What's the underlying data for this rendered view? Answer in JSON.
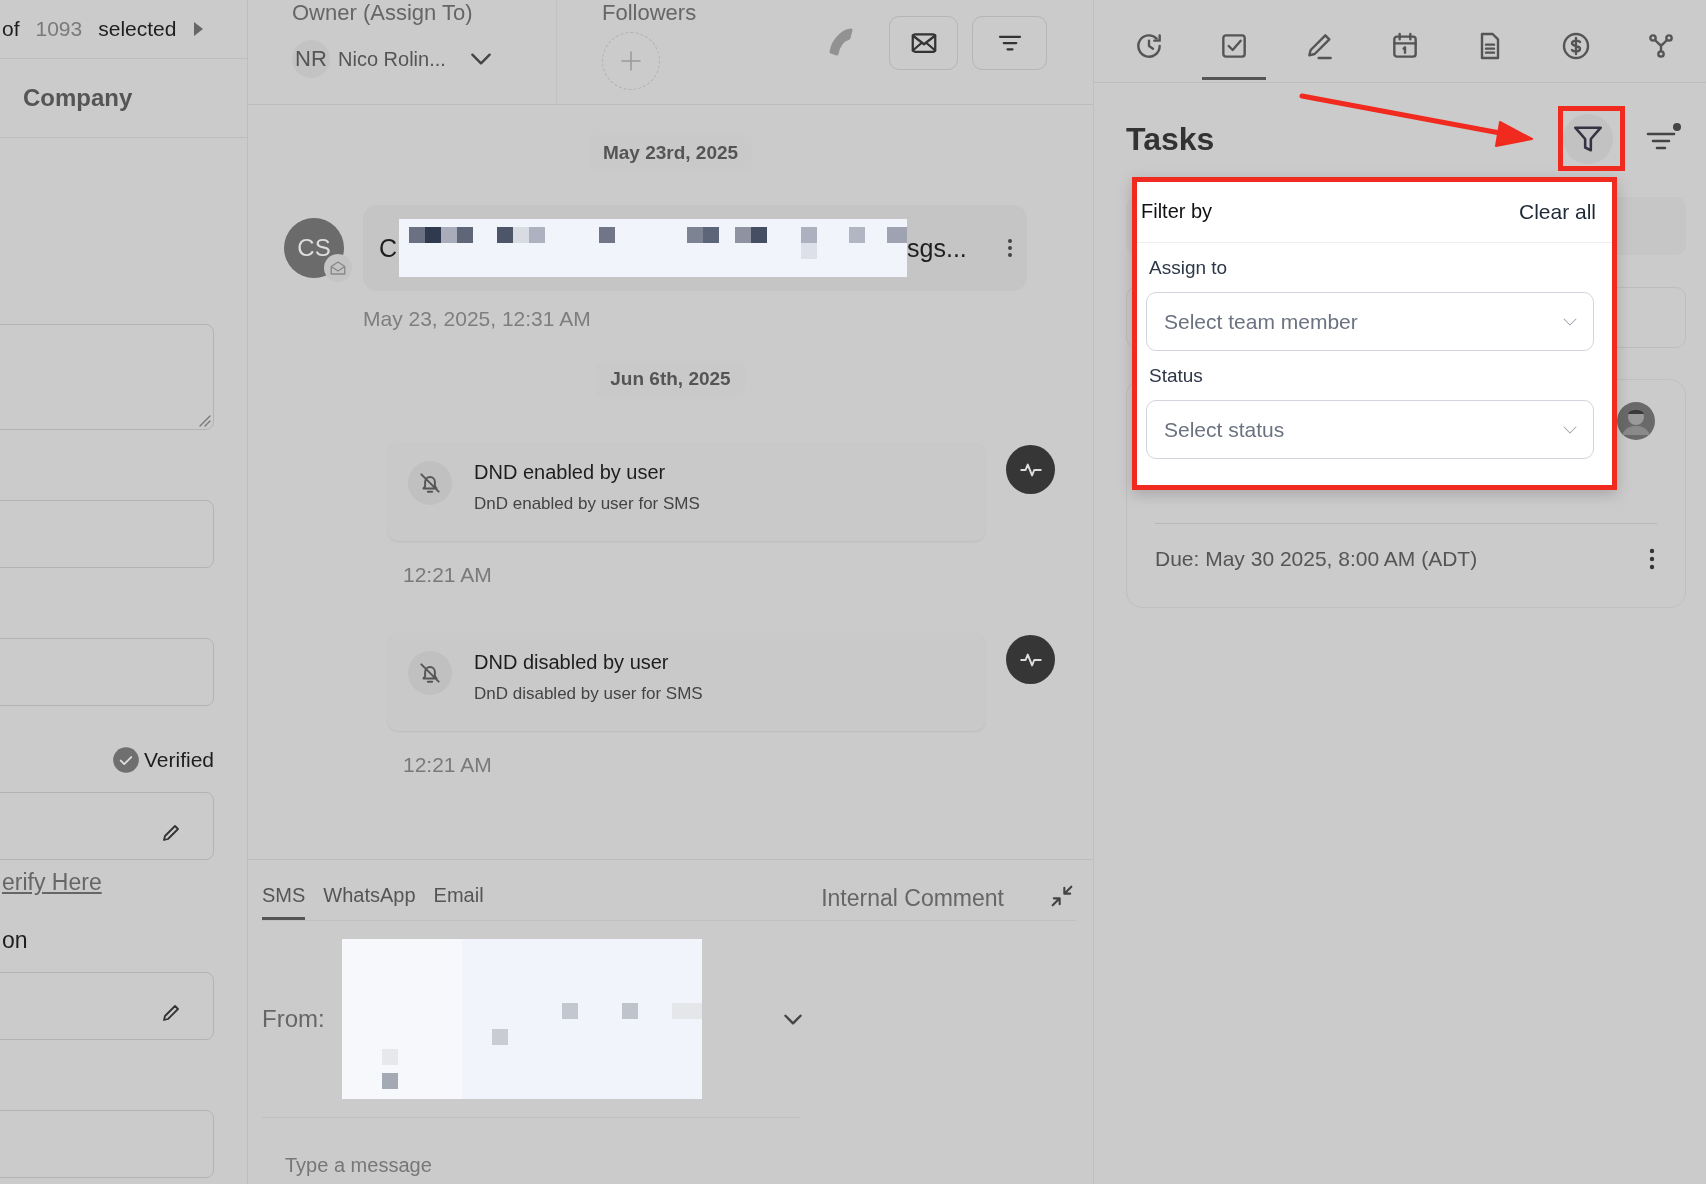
{
  "contact_panel": {
    "selection": {
      "prefix": "of",
      "count": "1093",
      "label": "selected"
    },
    "section_title": "Company",
    "fields": [
      {
        "kind": "textarea"
      },
      {
        "kind": "input"
      },
      {
        "kind": "input"
      },
      {
        "kind": "badge",
        "text": "Verified"
      },
      {
        "kind": "editable"
      },
      {
        "kind": "link",
        "text": "erify Here"
      },
      {
        "kind": "label",
        "text": "on"
      },
      {
        "kind": "editable"
      },
      {
        "kind": "input"
      }
    ]
  },
  "conversation": {
    "header": {
      "owner_label": "Owner (Assign To)",
      "owner_initials": "NR",
      "owner_name": "Nico Rolin...",
      "followers_label": "Followers"
    },
    "groups": [
      {
        "date": "May 23rd, 2025",
        "items": [
          {
            "kind": "message",
            "initials": "CS",
            "prefix": "C",
            "suffix": "sgs...",
            "time": "May 23, 2025, 12:31 AM"
          }
        ]
      },
      {
        "date": "Jun 6th, 2025",
        "items": [
          {
            "kind": "event",
            "title": "DND enabled by user",
            "detail": "DnD enabled by user for SMS",
            "time": "12:21 AM"
          },
          {
            "kind": "event",
            "title": "DND disabled by user",
            "detail": "DnD disabled by user for SMS",
            "time": "12:21 AM"
          }
        ]
      }
    ],
    "composer": {
      "tabs": [
        {
          "label": "SMS",
          "selected": true
        },
        {
          "label": "WhatsApp",
          "selected": false
        },
        {
          "label": "Email",
          "selected": false
        }
      ],
      "internal_label": "Internal Comment",
      "from_label": "From:",
      "placeholder": "Type a message"
    }
  },
  "tasks_panel": {
    "tabs": [
      {
        "kind": "history",
        "selected": false
      },
      {
        "kind": "tasks",
        "selected": true
      },
      {
        "kind": "notes",
        "selected": false
      },
      {
        "kind": "calendar",
        "selected": false
      },
      {
        "kind": "documents",
        "selected": false
      },
      {
        "kind": "payments",
        "selected": false
      },
      {
        "kind": "workflows",
        "selected": false
      }
    ],
    "title": "Tasks",
    "filter_popup": {
      "title": "Filter by",
      "clear": "Clear all",
      "filters": [
        {
          "label": "Assign to",
          "placeholder": "Select team member"
        },
        {
          "label": "Status",
          "placeholder": "Select status"
        }
      ]
    },
    "task": {
      "due": "Due: May 30 2025, 8:00 AM (ADT)"
    }
  }
}
